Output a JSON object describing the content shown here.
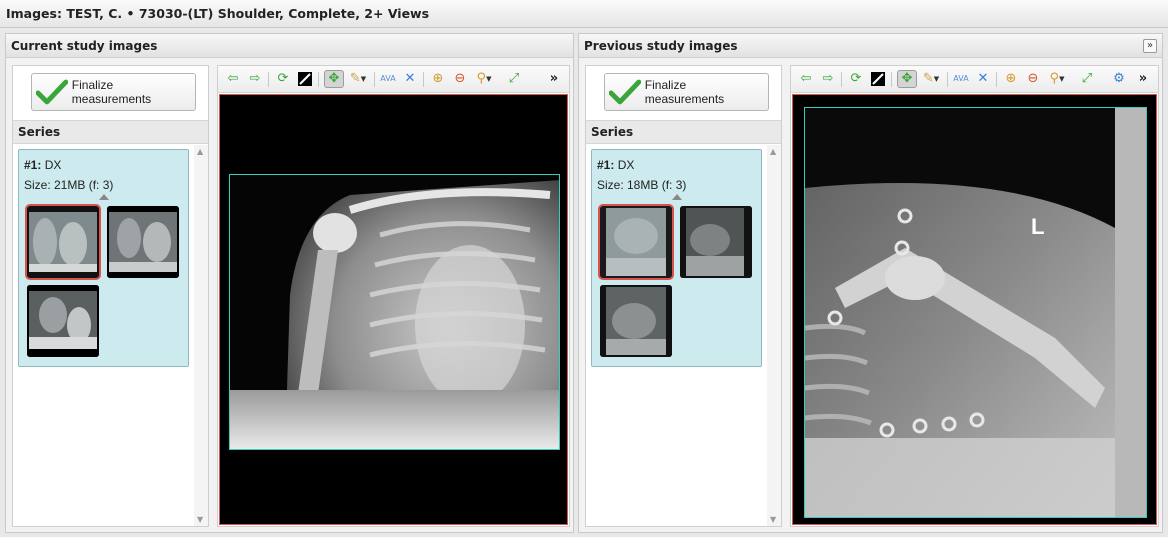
{
  "window": {
    "title": "Images: TEST, C. • 73030-(LT) Shoulder, Complete, 2+ Views"
  },
  "current": {
    "title": "Current study images",
    "finalize_label": "Finalize measurements",
    "series_heading": "Series",
    "series": {
      "number": "#1:",
      "modality": "DX",
      "size_line": "Size: 21MB (f: 3)"
    },
    "thumbnails": [
      {
        "name": "frame-1",
        "selected": true
      },
      {
        "name": "frame-2",
        "selected": false
      },
      {
        "name": "frame-3",
        "selected": false
      }
    ]
  },
  "previous": {
    "title": "Previous study images",
    "collapse_label": "»",
    "finalize_label": "Finalize measurements",
    "series_heading": "Series",
    "series": {
      "number": "#1:",
      "modality": "DX",
      "size_line": "Size: 18MB (f: 3)"
    },
    "side_marker": "L",
    "thumbnails": [
      {
        "name": "frame-1",
        "selected": true
      },
      {
        "name": "frame-2",
        "selected": false
      },
      {
        "name": "frame-3",
        "selected": false
      }
    ]
  },
  "toolbar": {
    "icons": [
      "prev-arrow-icon",
      "next-arrow-icon",
      "rotate-icon",
      "invert-icon",
      "pan-icon",
      "annotate-icon",
      "measure-ava-icon",
      "crosshair-icon",
      "zoom-in-icon",
      "zoom-out-icon",
      "magnifier-icon",
      "fit-icon",
      "more-icon"
    ],
    "ava_label": "AVA",
    "more_label": "»"
  },
  "colors": {
    "series_card_bg": "#cdebee",
    "selected_outline": "#d9534f",
    "viewport_border": "#d9534f",
    "image_frame": "#3cc9c0",
    "check_green": "#3aa53a"
  }
}
